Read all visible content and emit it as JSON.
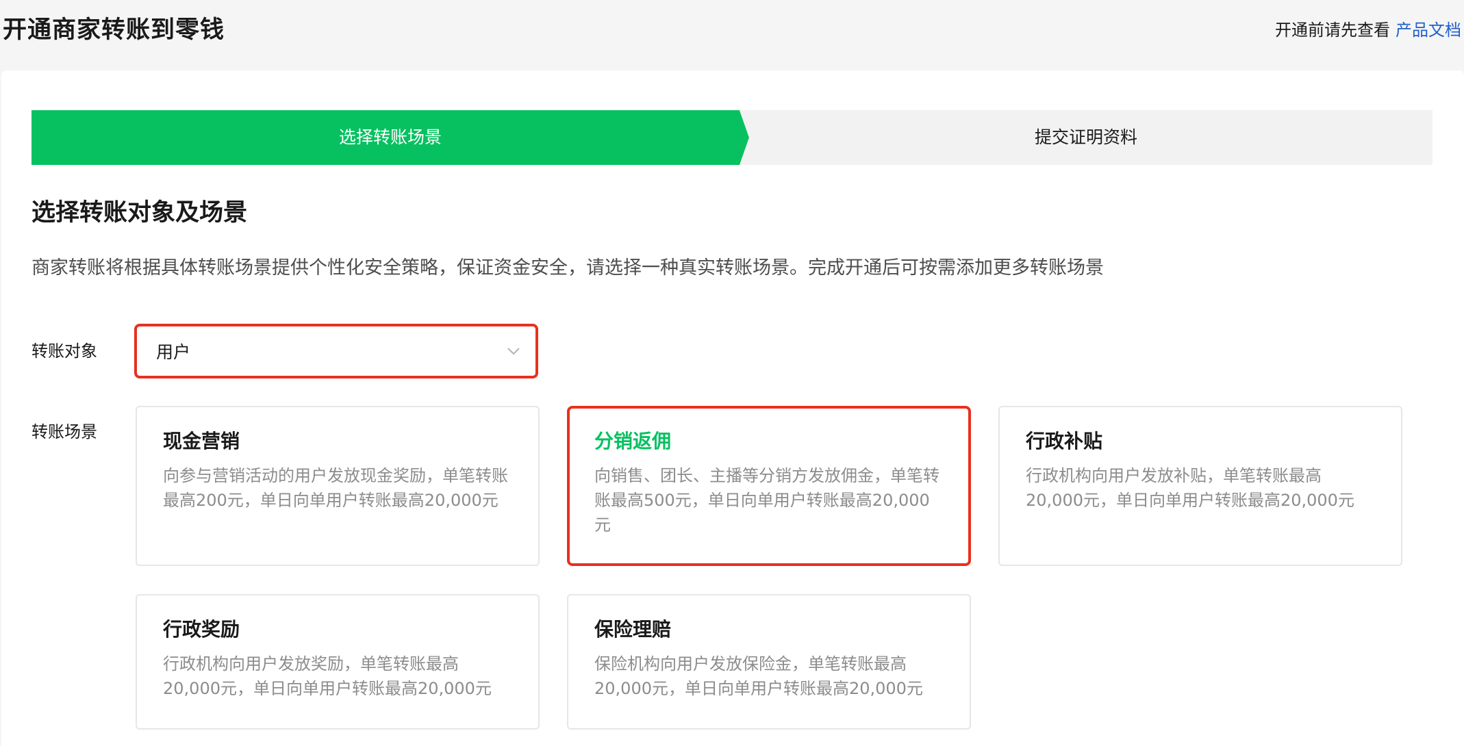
{
  "header": {
    "title": "开通商家转账到零钱",
    "hint": "开通前请先查看",
    "doc_link": "产品文档"
  },
  "steps": [
    {
      "label": "选择转账场景",
      "state": "active"
    },
    {
      "label": "提交证明资料",
      "state": "pending"
    }
  ],
  "section": {
    "title": "选择转账对象及场景",
    "description": "商家转账将根据具体转账场景提供个性化安全策略，保证资金安全，请选择一种真实转账场景。完成开通后可按需添加更多转账场景"
  },
  "form": {
    "target_label": "转账对象",
    "target_value": "用户",
    "scene_label": "转账场景"
  },
  "scenes": [
    {
      "title": "现金营销",
      "desc": "向参与营销活动的用户发放现金奖励，单笔转账最高200元，单日向单用户转账最高20,000元",
      "selected": false
    },
    {
      "title": "分销返佣",
      "desc": "向销售、团长、主播等分销方发放佣金，单笔转账最高500元，单日向单用户转账最高20,000元",
      "selected": true
    },
    {
      "title": "行政补贴",
      "desc": "行政机构向用户发放补贴，单笔转账最高20,000元，单日向单用户转账最高20,000元",
      "selected": false
    },
    {
      "title": "行政奖励",
      "desc": "行政机构向用户发放奖励，单笔转账最高20,000元，单日向单用户转账最高20,000元",
      "selected": false
    },
    {
      "title": "保险理赔",
      "desc": "保险机构向用户发放保险金，单笔转账最高20,000元，单日向单用户转账最高20,000元",
      "selected": false
    }
  ],
  "colors": {
    "accent": "#07c160",
    "highlight": "#e8301e",
    "link": "#1f5fc9"
  },
  "icons": {
    "select_arrow": "chevron-down-icon"
  }
}
